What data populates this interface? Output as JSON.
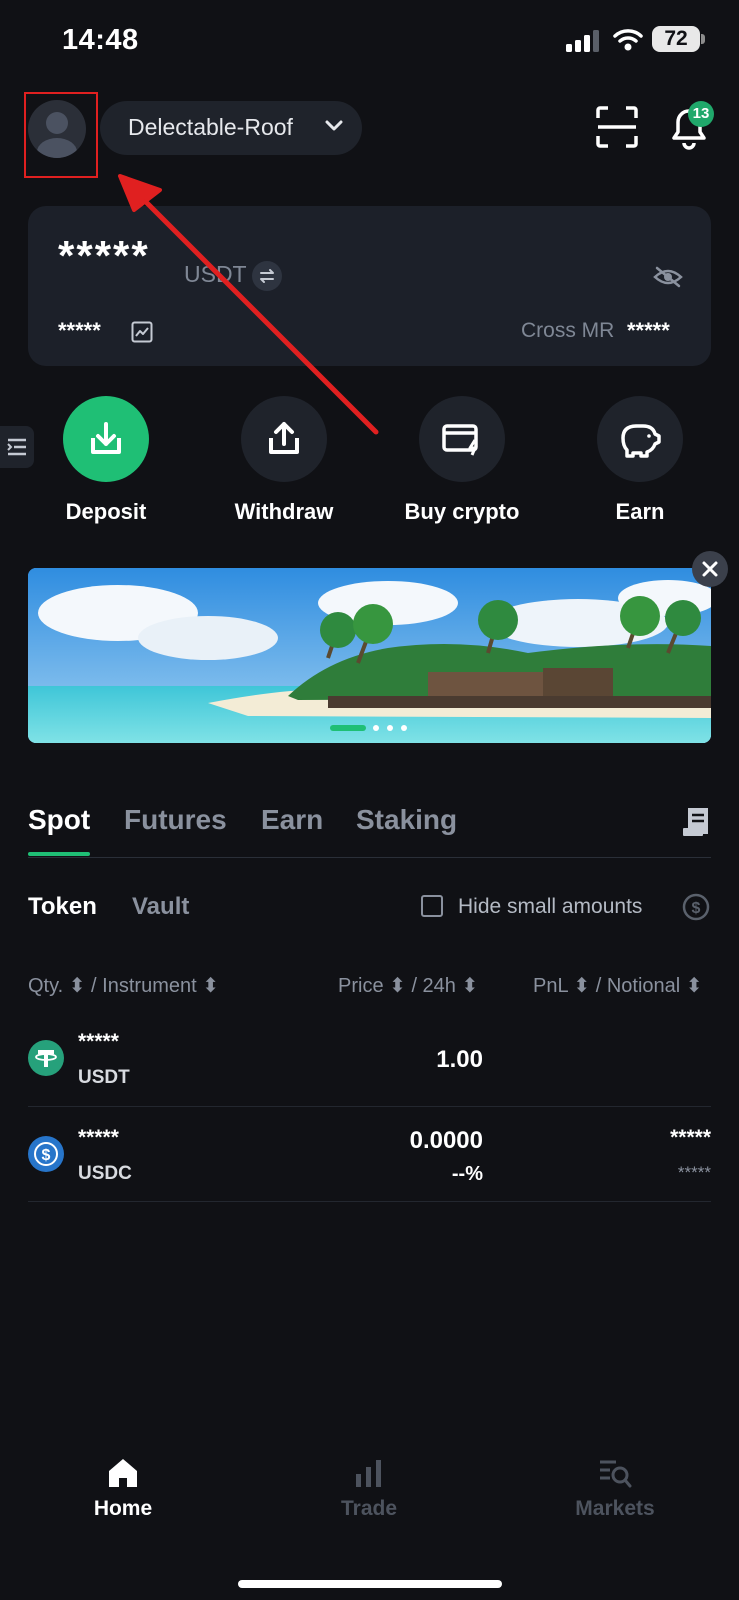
{
  "status_bar": {
    "time": "14:48",
    "battery": "72"
  },
  "header": {
    "account_name": "Delectable-Roof",
    "notification_count": "13",
    "icons": [
      "avatar",
      "chevron-down-icon",
      "scan-icon",
      "bell-icon"
    ]
  },
  "balance": {
    "amount": "*****",
    "currency": "USDT",
    "secondary": "*****",
    "cross_mr_label": "Cross MR",
    "cross_mr_value": "*****"
  },
  "actions": [
    {
      "label": "Deposit",
      "icon": "deposit-icon"
    },
    {
      "label": "Withdraw",
      "icon": "withdraw-icon"
    },
    {
      "label": "Buy crypto",
      "icon": "card-icon"
    },
    {
      "label": "Earn",
      "icon": "piggy-bank-icon"
    }
  ],
  "tabs": [
    "Spot",
    "Futures",
    "Earn",
    "Staking"
  ],
  "subtabs": [
    "Token",
    "Vault"
  ],
  "hide_small_amounts": "Hide small amounts",
  "columns": {
    "left": "Qty. ⬍ / Instrument ⬍",
    "middle": "Price ⬍ / 24h ⬍",
    "right": "PnL ⬍ / Notional ⬍"
  },
  "assets": [
    {
      "qty": "*****",
      "symbol": "USDT",
      "price": "1.00",
      "change": "",
      "pnl": "",
      "notional": ""
    },
    {
      "qty": "*****",
      "symbol": "USDC",
      "price": "0.0000",
      "change": "--%",
      "pnl": "*****",
      "notional": "*****"
    }
  ],
  "bottom_nav": [
    {
      "label": "Home",
      "active": true
    },
    {
      "label": "Trade",
      "active": false
    },
    {
      "label": "Markets",
      "active": false
    }
  ],
  "colors": {
    "background": "#101115",
    "card": "#1c2029",
    "accent": "#1fbf75",
    "annotation": "#e02020"
  }
}
